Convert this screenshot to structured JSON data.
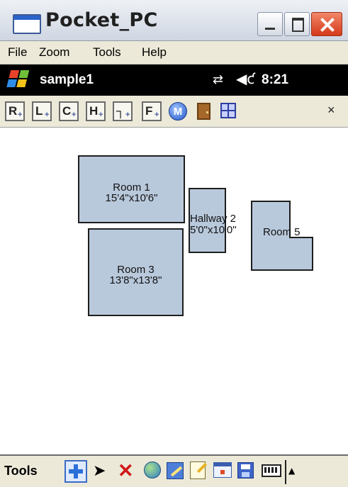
{
  "window": {
    "title": "Pocket_PC",
    "icons": {
      "app": "window-app-icon",
      "minimize": "minimize-icon",
      "maximize": "maximize-icon",
      "close": "close-icon"
    }
  },
  "menubar": {
    "items": [
      {
        "label": "File"
      },
      {
        "label": "Zoom"
      },
      {
        "label": "Tools"
      },
      {
        "label": "Help"
      }
    ]
  },
  "statusbar": {
    "title": "sample1",
    "time": "8:21",
    "icons": {
      "start": "windows-flag-icon",
      "connectivity": "connectivity-icon",
      "volume": "volume-icon"
    }
  },
  "drawing_toolbar": {
    "tools": [
      {
        "letter": "R",
        "icon": "add-rectangle-room-icon"
      },
      {
        "letter": "L",
        "icon": "add-l-room-icon"
      },
      {
        "letter": "C",
        "icon": "add-c-room-icon"
      },
      {
        "letter": "H",
        "icon": "add-h-room-icon"
      },
      {
        "letter": "┐",
        "icon": "add-polygon-room-icon"
      },
      {
        "letter": "F",
        "icon": "add-free-room-icon"
      }
    ],
    "measure_letter": "M",
    "close_symbol": "×"
  },
  "canvas": {
    "rooms": [
      {
        "name": "Room 1",
        "dimensions": "15'4\"x10'6\""
      },
      {
        "name": "Hallway 2",
        "dimensions": "5'0\"x10'0\""
      },
      {
        "name": "Room 3",
        "dimensions": "13'8\"x13'8\""
      },
      {
        "name": "Room 5",
        "dimensions": ""
      }
    ]
  },
  "bottom_toolbar": {
    "label": "Tools",
    "icons": [
      "add-icon",
      "pointer-icon",
      "delete-icon",
      "satellite-icon",
      "edit-icon",
      "note-icon",
      "view-icon",
      "save-icon",
      "keyboard-icon"
    ],
    "sip_arrow": "▲"
  },
  "colors": {
    "room_fill": "#b9c9dc",
    "room_border": "#1e1e1e",
    "titlebar": "#cfd6e2",
    "menubar": "#ece9d8",
    "statusbar": "#000000",
    "close_button": "#d4391a"
  }
}
